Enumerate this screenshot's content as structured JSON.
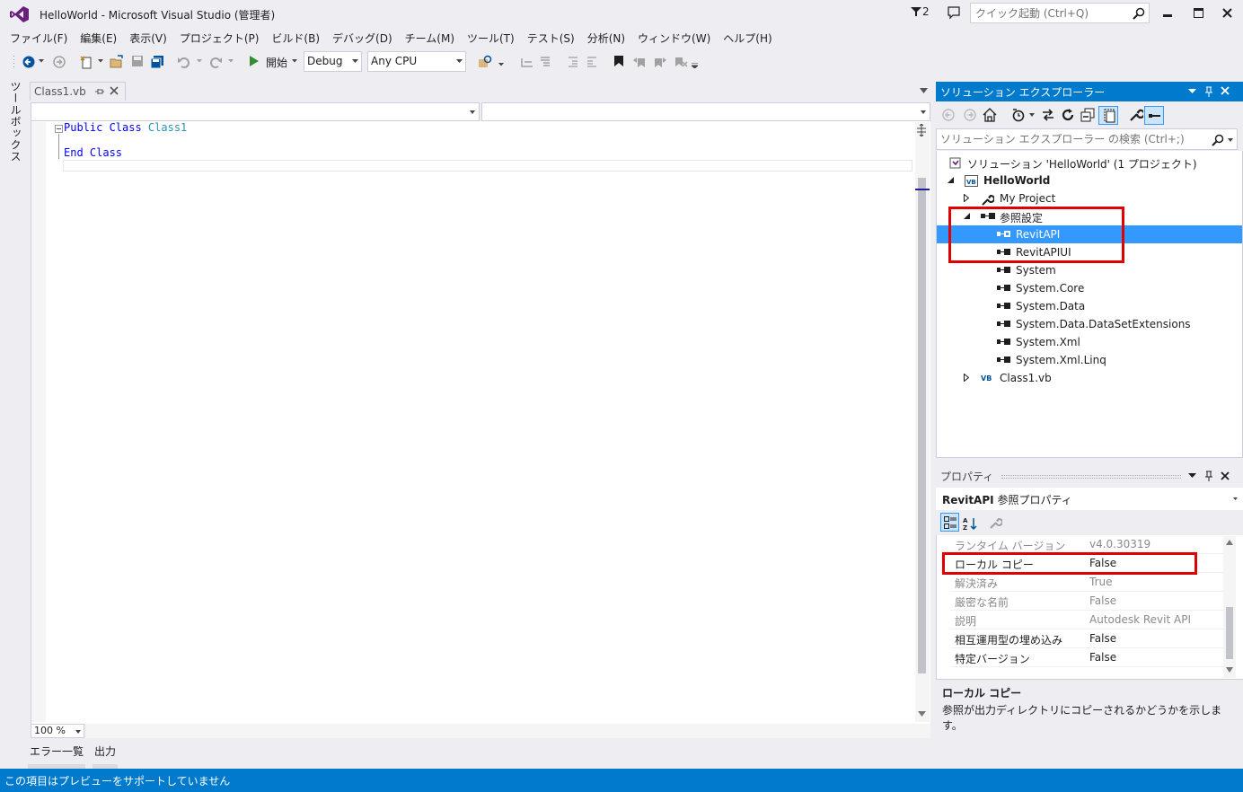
{
  "window": {
    "title": "HelloWorld - Microsoft Visual Studio (管理者)",
    "notification_count": "2",
    "quick_launch_placeholder": "クイック起動 (Ctrl+Q)"
  },
  "menu": [
    "ファイル(F)",
    "編集(E)",
    "表示(V)",
    "プロジェクト(P)",
    "ビルド(B)",
    "デバッグ(D)",
    "チーム(M)",
    "ツール(T)",
    "テスト(S)",
    "分析(N)",
    "ウィンドウ(W)",
    "ヘルプ(H)"
  ],
  "toolbar": {
    "start_label": "開始",
    "config": "Debug",
    "platform": "Any CPU"
  },
  "toolbox_label": "ツールボックス",
  "editor": {
    "tab_name": "Class1.vb",
    "code": {
      "line1_kw": "Public Class ",
      "line1_type": "Class1",
      "line2": "End Class"
    },
    "zoom": "100 %"
  },
  "bottom_tabs": [
    "エラー一覧",
    "出力"
  ],
  "status": "この項目はプレビューをサポートしていません",
  "solution_explorer": {
    "title": "ソリューション エクスプローラー",
    "search_placeholder": "ソリューション エクスプローラー の検索 (Ctrl+;)",
    "tree": [
      {
        "label": "ソリューション 'HelloWorld' (1 プロジェクト)",
        "icon": "solution-icon"
      },
      {
        "label": "HelloWorld",
        "icon": "vb-project-icon",
        "bold": true
      },
      {
        "label": "My Project",
        "icon": "wrench-icon"
      },
      {
        "label": "参照設定",
        "icon": "references-icon"
      },
      {
        "label": "RevitAPI",
        "icon": "reference-icon",
        "selected": true
      },
      {
        "label": "RevitAPIUI",
        "icon": "reference-icon"
      },
      {
        "label": "System",
        "icon": "reference-icon"
      },
      {
        "label": "System.Core",
        "icon": "reference-icon"
      },
      {
        "label": "System.Data",
        "icon": "reference-icon"
      },
      {
        "label": "System.Data.DataSetExtensions",
        "icon": "reference-icon"
      },
      {
        "label": "System.Xml",
        "icon": "reference-icon"
      },
      {
        "label": "System.Xml.Linq",
        "icon": "reference-icon"
      },
      {
        "label": "Class1.vb",
        "icon": "vb-file-icon"
      }
    ]
  },
  "properties": {
    "title": "プロパティ",
    "object": "RevitAPI",
    "object_type": "参照プロパティ",
    "rows": [
      {
        "name": "ランタイム バージョン",
        "value": "v4.0.30319",
        "readonly": true
      },
      {
        "name": "ローカル コピー",
        "value": "False",
        "readonly": false
      },
      {
        "name": "解決済み",
        "value": "True",
        "readonly": true
      },
      {
        "name": "厳密な名前",
        "value": "False",
        "readonly": true
      },
      {
        "name": "説明",
        "value": "Autodesk Revit API",
        "readonly": true
      },
      {
        "name": "相互運用型の埋め込み",
        "value": "False",
        "readonly": false
      },
      {
        "name": "特定バージョン",
        "value": "False",
        "readonly": false
      }
    ],
    "desc_title": "ローカル コピー",
    "desc_text": "参照が出力ディレクトリにコピーされるかどうかを示します。"
  },
  "colors": {
    "accent": "#007acc",
    "selection": "#3399ff",
    "highlight_box": "#e00000"
  }
}
